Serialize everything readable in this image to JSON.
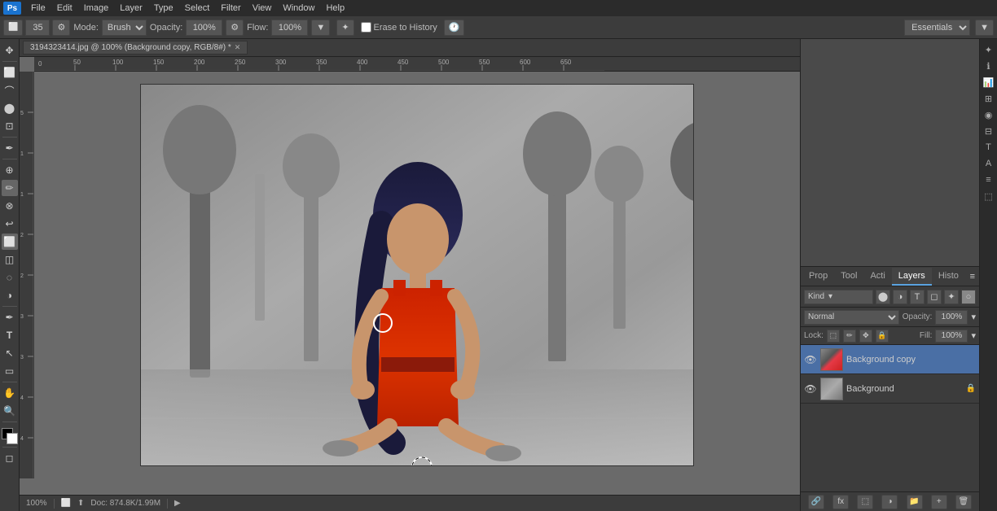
{
  "app": {
    "logo": "Ps",
    "workspace": "Essentials"
  },
  "menubar": {
    "items": [
      "File",
      "Edit",
      "Image",
      "Layer",
      "Type",
      "Select",
      "Filter",
      "View",
      "Window",
      "Help"
    ]
  },
  "toolbar": {
    "mode_label": "Mode:",
    "mode_value": "Brush",
    "opacity_label": "Opacity:",
    "opacity_value": "100%",
    "flow_label": "Flow:",
    "flow_value": "100%",
    "erase_to_history": "Erase to History",
    "brush_size": "35",
    "workspace_value": "Essentials"
  },
  "document": {
    "title": "3194323414.jpg @ 100% (Background copy, RGB/8#) *",
    "zoom": "100%",
    "doc_info": "Doc: 874.8K/1.99M"
  },
  "layers": {
    "panel_tabs": [
      "Prop",
      "Tool",
      "Acti",
      "Layers",
      "Histo"
    ],
    "active_tab": "Layers",
    "search_placeholder": "Kind",
    "blending_mode": "Normal",
    "opacity_label": "Opacity:",
    "opacity_value": "100%",
    "lock_label": "Lock:",
    "fill_label": "Fill:",
    "fill_value": "100%",
    "items": [
      {
        "name": "Background copy",
        "visible": true,
        "active": true,
        "locked": false
      },
      {
        "name": "Background",
        "visible": true,
        "active": false,
        "locked": true
      }
    ],
    "footer_buttons": [
      "link",
      "fx",
      "mask",
      "adjustment",
      "group",
      "new",
      "delete"
    ]
  },
  "status": {
    "zoom": "100%",
    "doc_info": "Doc: 874.8K/1.99M"
  },
  "icons": {
    "eye": "👁",
    "lock": "🔒",
    "search": "🔍",
    "move": "✥",
    "eraser": "◻",
    "brush": "✏",
    "zoom_tool": "🔍",
    "close": "✕",
    "min": "─",
    "max": "□"
  }
}
